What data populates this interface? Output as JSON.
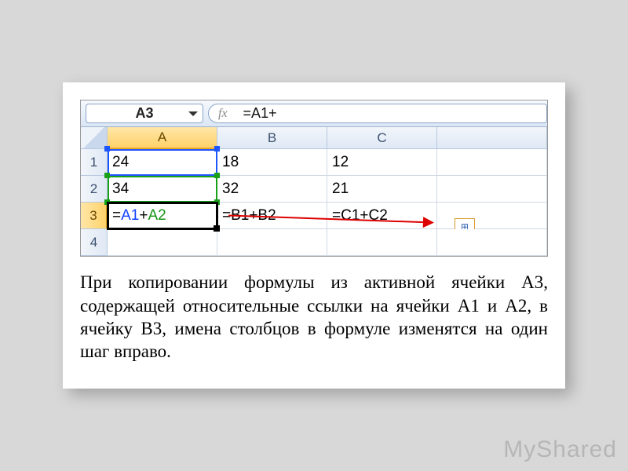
{
  "formula_bar": {
    "name_box": "A3",
    "fx_label": "fx",
    "formula_value": "=A1+"
  },
  "columns": [
    "A",
    "B",
    "C"
  ],
  "rows": [
    "1",
    "2",
    "3",
    "4"
  ],
  "cells": {
    "A1": "24",
    "B1": "18",
    "C1": "12",
    "A2": "34",
    "B2": "32",
    "C2": "21",
    "A3_prefix": "=",
    "A3_ref1": "A1",
    "A3_plus": "+",
    "A3_ref2": "A2",
    "B3": "=B1+B2",
    "C3": "=C1+C2"
  },
  "autofill_opts_icon": "⊞",
  "paragraph": "При копировании формулы из активной ячейки А3, содержащей относительные ссылки на ячейки А1 и А2, в ячейку В3, имена столбцов в формуле изменятся на один шаг вправо.",
  "watermark": "MyShared"
}
